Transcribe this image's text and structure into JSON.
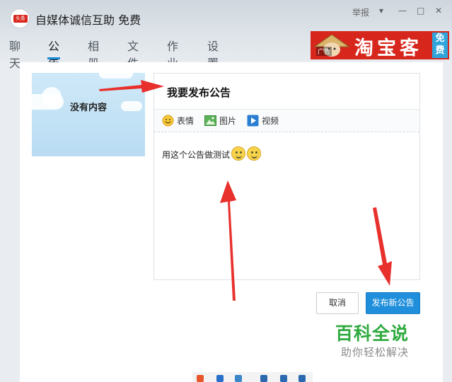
{
  "window": {
    "title": "自媒体诚信互助 免费",
    "logo_text": "头条",
    "report_label": "举报",
    "controls": [
      "▾",
      "—",
      "□",
      "✕"
    ]
  },
  "tabs": [
    {
      "label": "聊天",
      "active": false
    },
    {
      "label": "公告",
      "active": true
    },
    {
      "label": "相册",
      "active": false
    },
    {
      "label": "文件",
      "active": false
    },
    {
      "label": "作业",
      "active": false
    },
    {
      "label": "设置",
      "active": false,
      "caret": "▾"
    }
  ],
  "ad": {
    "tag": "广告",
    "brand": "淘宝客",
    "side": "免费"
  },
  "sidebar": {
    "empty_text": "没有内容"
  },
  "editor": {
    "title": "我要发布公告",
    "toolbar": [
      {
        "icon": "emoji-icon",
        "label": "表情"
      },
      {
        "icon": "image-icon",
        "label": "图片"
      },
      {
        "icon": "video-icon",
        "label": "视频"
      }
    ],
    "body_text": "用这个公告做测试"
  },
  "actions": {
    "cancel_label": "取消",
    "publish_label": "发布新公告"
  },
  "watermark": {
    "title": "百科全说",
    "subtitle": "助你轻松解决"
  },
  "colors": {
    "accent": "#1f8fdb",
    "arrow": "#e8302c",
    "watermark": "#2eaa3e"
  }
}
